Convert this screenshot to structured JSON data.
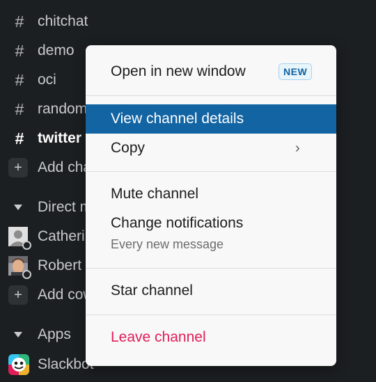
{
  "sidebar": {
    "channels": [
      {
        "label": "chitchat"
      },
      {
        "label": "demo"
      },
      {
        "label": "oci"
      },
      {
        "label": "random"
      },
      {
        "label": "twitter"
      }
    ],
    "add_channels_label": "Add channels",
    "direct_messages_label": "Direct messages",
    "dm_users": [
      {
        "label": "Catherine"
      },
      {
        "label": "Robert"
      }
    ],
    "add_coworkers_label": "Add coworkers",
    "apps_label": "Apps",
    "slackbot_label": "Slackbot"
  },
  "context_menu": {
    "open_new_window": "Open in new window",
    "new_badge": "NEW",
    "view_channel_details": "View channel details",
    "copy": "Copy",
    "copy_chevron": "›",
    "mute_channel": "Mute channel",
    "change_notifications": "Change notifications",
    "notifications_value": "Every new message",
    "star_channel": "Star channel",
    "leave_channel": "Leave channel"
  },
  "colors": {
    "sidebar_bg": "#1c1f21",
    "menu_bg": "#f8f8f8",
    "active_bg": "#1264a3",
    "danger": "#e01e5a",
    "badge_text": "#1264a3"
  },
  "icons": {
    "channel": "hash-icon",
    "add": "plus-icon",
    "section": "caret-down-icon",
    "submenu": "chevron-right-icon"
  }
}
